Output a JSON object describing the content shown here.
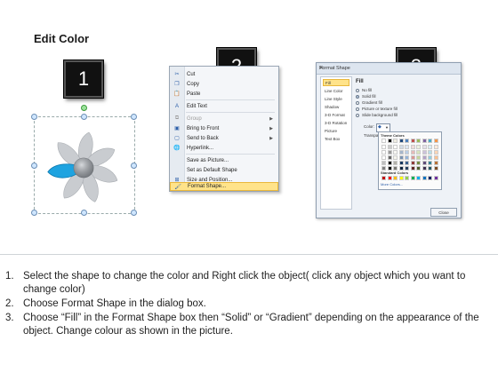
{
  "title": "Edit Color",
  "badges": [
    "1",
    "2",
    "3"
  ],
  "context_menu": {
    "items": [
      {
        "label": "Cut",
        "icon": "scissors-icon",
        "underline_char": "t",
        "disabled": false,
        "submenu": false
      },
      {
        "label": "Copy",
        "icon": "copy-icon",
        "disabled": false,
        "submenu": false
      },
      {
        "label": "Paste",
        "icon": "paste-icon",
        "disabled": false,
        "submenu": false
      },
      {
        "label": "Edit Text",
        "icon": "edit-text-icon",
        "disabled": false,
        "submenu": false
      },
      {
        "label": "Group",
        "icon": "group-icon",
        "disabled": true,
        "submenu": true
      },
      {
        "label": "Bring to Front",
        "icon": "bring-front-icon",
        "disabled": false,
        "submenu": true
      },
      {
        "label": "Send to Back",
        "icon": "send-back-icon",
        "disabled": false,
        "submenu": true
      },
      {
        "label": "Hyperlink...",
        "icon": "hyperlink-icon",
        "disabled": false,
        "submenu": false
      },
      {
        "label": "Save as Picture...",
        "icon": "",
        "disabled": false,
        "submenu": false
      },
      {
        "label": "Set as Default Shape",
        "icon": "",
        "disabled": false,
        "submenu": false
      },
      {
        "label": "Size and Position...",
        "icon": "size-position-icon",
        "disabled": false,
        "submenu": false
      },
      {
        "label": "Format Shape...",
        "icon": "format-shape-icon",
        "disabled": false,
        "submenu": false,
        "highlighted": true
      }
    ]
  },
  "format_dialog": {
    "title": "Format Shape",
    "close": "✕",
    "nav": [
      "Fill",
      "Line Color",
      "Line Style",
      "Shadow",
      "3-D Format",
      "3-D Rotation",
      "Picture",
      "Text Box"
    ],
    "selected_nav": "Fill",
    "heading": "Fill",
    "options": [
      "No fill",
      "Solid fill",
      "Gradient fill",
      "Picture or texture fill",
      "Slide background fill"
    ],
    "selected_option": "Solid fill",
    "color_label": "Color:",
    "transparency_label": "Transparen",
    "theme_colors_label": "Theme Colors",
    "standard_colors_label": "Standard Colors",
    "more_colors": "More Colors...",
    "close_button": "Close",
    "theme_colors": [
      "#ffffff",
      "#000000",
      "#eeece1",
      "#1f497d",
      "#4f81bd",
      "#c0504d",
      "#9bbb59",
      "#8064a2",
      "#4bacc6",
      "#f79646"
    ],
    "standard_colors": [
      "#c00000",
      "#ff0000",
      "#ffc000",
      "#ffff00",
      "#92d050",
      "#00b050",
      "#00b0f0",
      "#0070c0",
      "#002060",
      "#7030a0"
    ]
  },
  "instructions": [
    {
      "num": "1.",
      "text": "Select the shape to change the color and Right click the object( click any object which you want to change color)"
    },
    {
      "num": "2.",
      "text": "Choose Format Shape in the dialog box."
    },
    {
      "num": "3.",
      "text": "Choose “Fill” in the Format Shape box then “Solid” or “Gradient” depending on the appearance of the object. Change colour as shown in the picture."
    }
  ]
}
